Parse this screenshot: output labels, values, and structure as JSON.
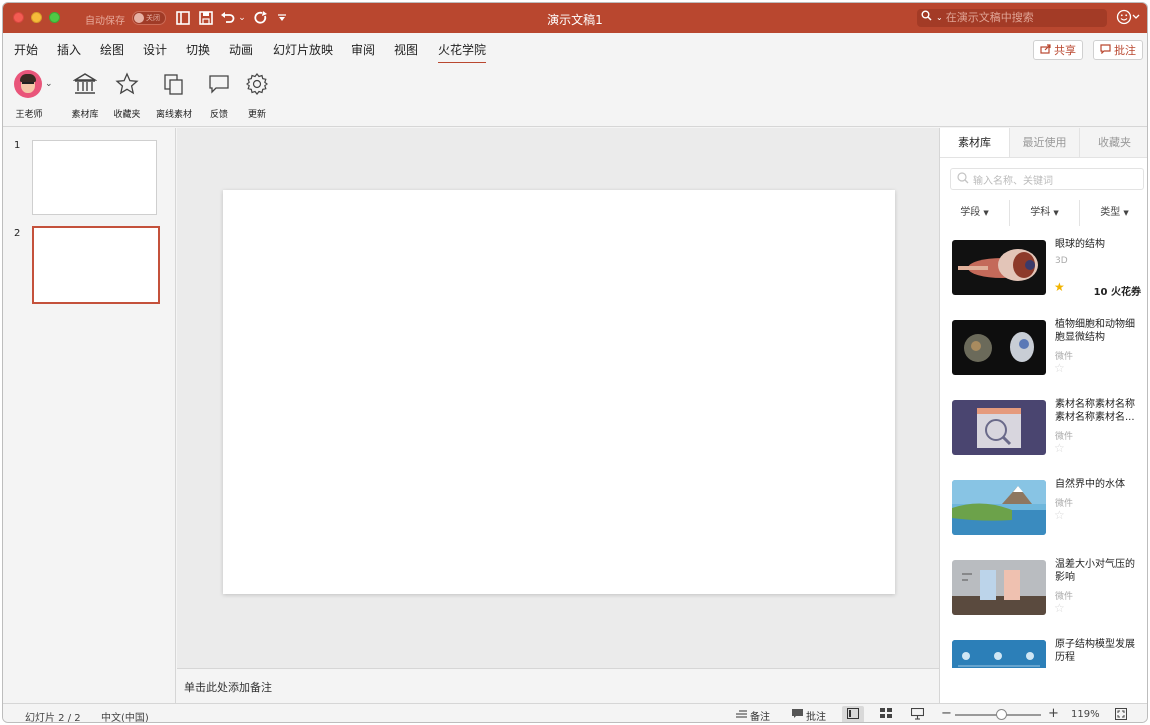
{
  "titlebar": {
    "autosave_label": "自动保存",
    "autosave_toggle": "关闭",
    "doc_title": "演示文稿1",
    "search_placeholder": "在演示文稿中搜索"
  },
  "menu": {
    "tabs": [
      "开始",
      "插入",
      "绘图",
      "设计",
      "切换",
      "动画",
      "幻灯片放映",
      "审阅",
      "视图",
      "火花学院"
    ],
    "active_tab": "火花学院",
    "share_label": "共享",
    "comment_label": "批注"
  },
  "ribbon": {
    "items": [
      {
        "label": "王老师",
        "icon": "avatar"
      },
      {
        "label": "素材库",
        "icon": "library-icon"
      },
      {
        "label": "收藏夹",
        "icon": "star-icon"
      },
      {
        "label": "离线素材",
        "icon": "copy-icon"
      },
      {
        "label": "反馈",
        "icon": "chat-icon"
      },
      {
        "label": "更新",
        "icon": "gear-icon"
      }
    ]
  },
  "slides": [
    {
      "number": "1",
      "selected": false
    },
    {
      "number": "2",
      "selected": true
    }
  ],
  "notes_placeholder": "单击此处添加备注",
  "right_panel": {
    "tabs": [
      "素材库",
      "最近使用",
      "收藏夹"
    ],
    "search_placeholder": "输入名称、关键词",
    "filters": [
      "学段",
      "学科",
      "类型"
    ],
    "resources": [
      {
        "title": "眼球的结构",
        "type": "3D",
        "starred": true,
        "price": "10 火花券"
      },
      {
        "title": "植物细胞和动物细胞显微结构",
        "type": "微件",
        "starred": false,
        "price": ""
      },
      {
        "title": "素材名称素材名称素材名称素材名...",
        "type": "微件",
        "starred": false,
        "price": ""
      },
      {
        "title": "自然界中的水体",
        "type": "微件",
        "starred": false,
        "price": ""
      },
      {
        "title": "温差大小对气压的影响",
        "type": "微件",
        "starred": false,
        "price": ""
      },
      {
        "title": "原子结构模型发展历程",
        "type": "微件",
        "starred": false,
        "price": ""
      }
    ]
  },
  "statusbar": {
    "slide_info": "幻灯片 2 / 2",
    "language": "中文(中国)",
    "notes_label": "备注",
    "comments_label": "批注",
    "zoom": "119%",
    "zoom_minus": "−",
    "zoom_plus": "+"
  },
  "colors": {
    "accent": "#b9472f",
    "selection": "#c4513b"
  }
}
